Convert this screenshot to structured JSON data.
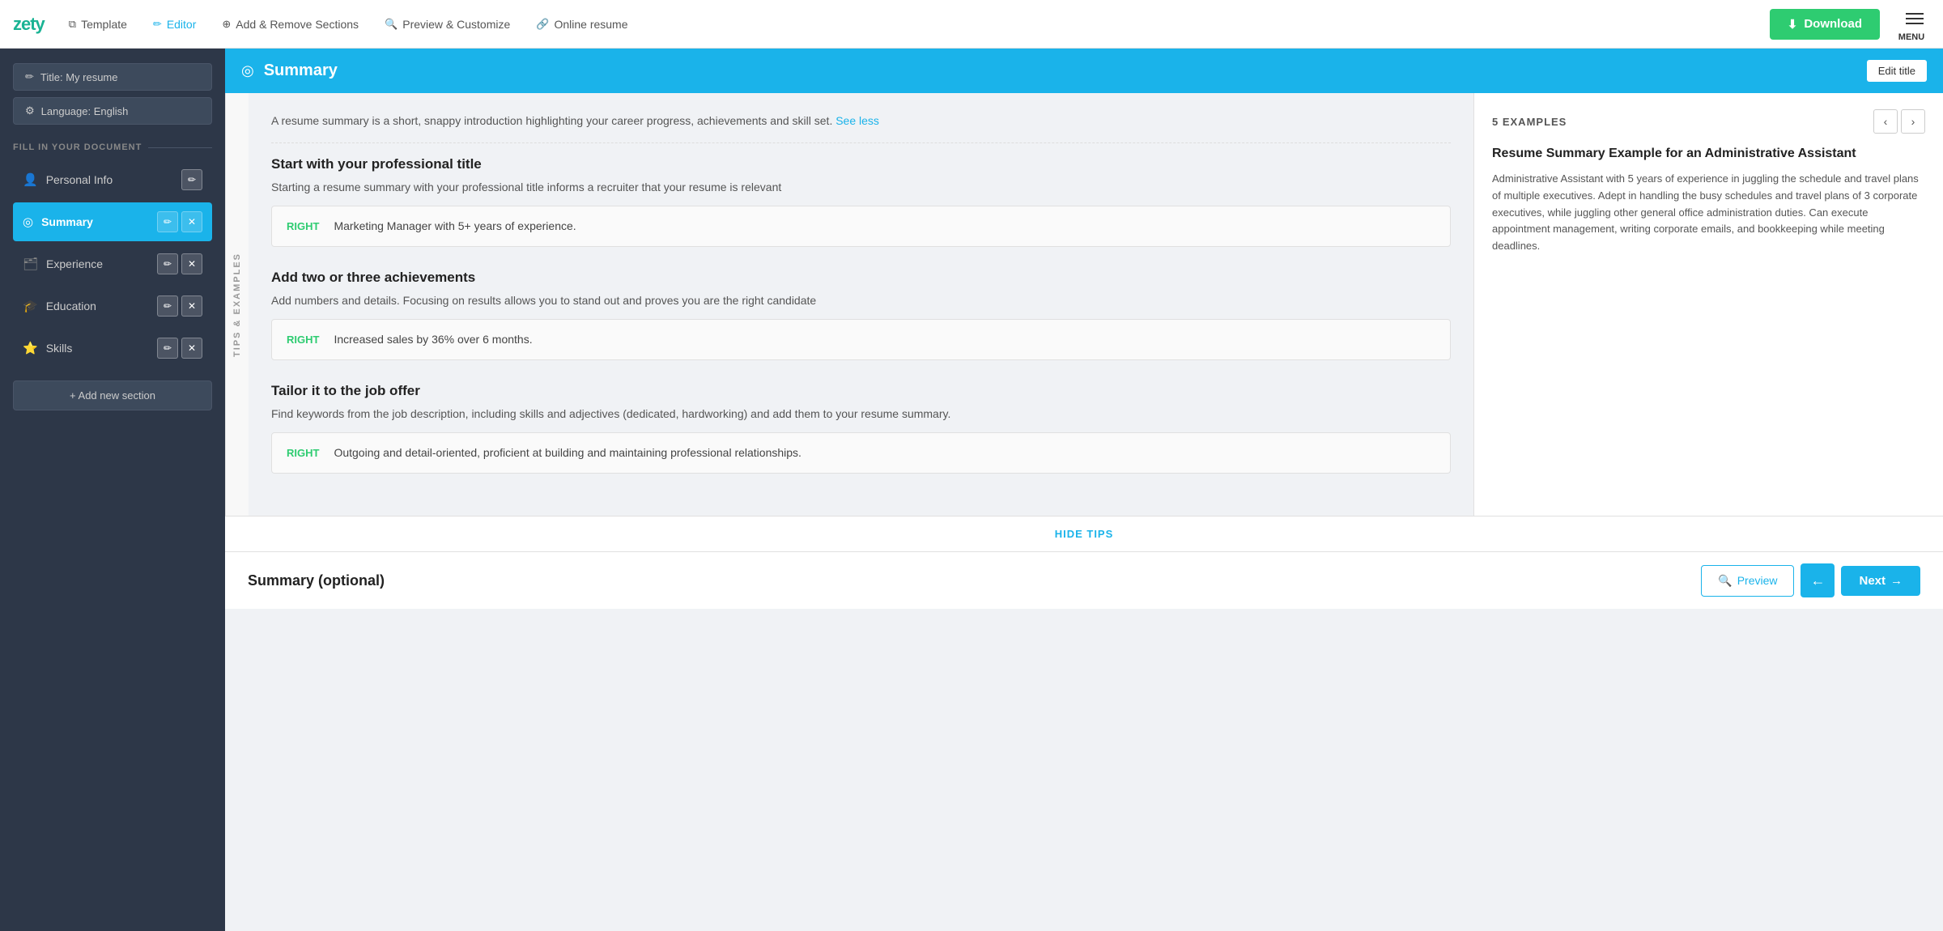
{
  "brand": {
    "name": "zety"
  },
  "topnav": {
    "items": [
      {
        "id": "template",
        "label": "Template",
        "icon": "⧉",
        "active": false
      },
      {
        "id": "editor",
        "label": "Editor",
        "icon": "✏",
        "active": true
      },
      {
        "id": "add-remove",
        "label": "Add & Remove Sections",
        "icon": "⊕",
        "active": false
      },
      {
        "id": "preview",
        "label": "Preview & Customize",
        "icon": "🔍",
        "active": false
      },
      {
        "id": "online",
        "label": "Online resume",
        "icon": "🔗",
        "active": false
      }
    ],
    "download_label": "Download",
    "menu_label": "MENU"
  },
  "sidebar": {
    "title_btn": "Title: My resume",
    "language_btn": "Language: English",
    "fill_label": "FILL IN YOUR DOCUMENT",
    "sections": [
      {
        "id": "personal-info",
        "label": "Personal Info",
        "icon": "👤",
        "active": false
      },
      {
        "id": "summary",
        "label": "Summary",
        "icon": "◎",
        "active": true
      },
      {
        "id": "experience",
        "label": "Experience",
        "icon": "🗂",
        "active": false
      },
      {
        "id": "education",
        "label": "Education",
        "icon": "🎓",
        "active": false
      },
      {
        "id": "skills",
        "label": "Skills",
        "icon": "⭐",
        "active": false
      }
    ],
    "add_section_label": "+ Add new section"
  },
  "section_header": {
    "title": "Summary",
    "edit_title_label": "Edit title",
    "icon": "◎"
  },
  "intro": {
    "text": "A resume summary is a short, snappy introduction highlighting your career progress, achievements and skill set.",
    "see_less": "See less"
  },
  "tips_label": "TIPS & EXAMPLES",
  "tips": [
    {
      "id": "tip-1",
      "title": "Start with your professional title",
      "desc": "Starting a resume summary with your professional title informs a recruiter that your resume is relevant",
      "example_label": "RIGHT",
      "example_text": "Marketing Manager with 5+ years of experience."
    },
    {
      "id": "tip-2",
      "title": "Add two or three achievements",
      "desc": "Add numbers and details. Focusing on results allows you to stand out and proves you are the right candidate",
      "example_label": "RIGHT",
      "example_text": "Increased sales by 36% over 6 months."
    },
    {
      "id": "tip-3",
      "title": "Tailor it to the job offer",
      "desc": "Find keywords from the job description, including skills and adjectives (dedicated, hardworking) and add them to your resume summary.",
      "example_label": "RIGHT",
      "example_text": "Outgoing and detail-oriented, proficient at building and maintaining professional relationships."
    }
  ],
  "examples": {
    "count_label": "5 EXAMPLES",
    "current_title": "Resume Summary Example for an Administrative Assistant",
    "current_text": "Administrative Assistant with 5 years of experience in juggling the schedule and travel plans of multiple executives. Adept in handling the busy schedules and travel plans of 3 corporate executives, while juggling other general office administration duties. Can execute appointment management, writing corporate emails, and bookkeeping while meeting deadlines."
  },
  "hide_tips_label": "HIDE TIPS",
  "bottom": {
    "summary_label": "Summary (optional)",
    "preview_label": "Preview",
    "next_label": "Next",
    "nav_prev": "←",
    "nav_next": "→"
  }
}
